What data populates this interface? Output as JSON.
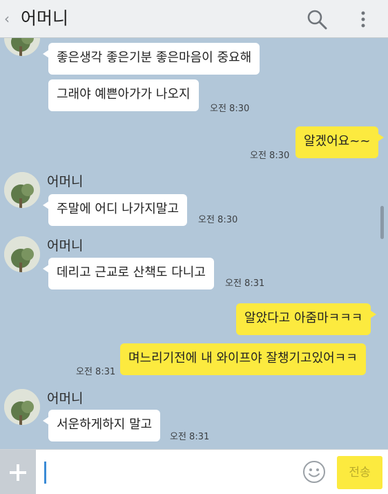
{
  "header": {
    "back_icon": "chevron-left-icon",
    "title": "어머니",
    "search_icon": "search-icon",
    "more_icon": "more-vertical-icon"
  },
  "colors": {
    "background": "#b2c7d9",
    "incoming_bubble": "#ffffff",
    "outgoing_bubble": "#fcea3f"
  },
  "messages": [
    {
      "direction": "in",
      "text": "좋은생각 좋은기분 좋은마음이 중요해"
    },
    {
      "direction": "in",
      "text": "그래야 예쁜아가가 나오지",
      "time": "오전 8:30"
    },
    {
      "direction": "out",
      "text": "알겠어요~~",
      "time": "오전 8:30"
    },
    {
      "direction": "in",
      "sender": "어머니",
      "text": "주말에 어디 나가지말고",
      "time": "오전 8:30"
    },
    {
      "direction": "in",
      "sender": "어머니",
      "text": "데리고 근교로 산책도 다니고",
      "time": "오전 8:31"
    },
    {
      "direction": "out",
      "text": "알았다고 아줌마ㅋㅋㅋ"
    },
    {
      "direction": "out",
      "text": "며느리기전에 내 와이프야 잘챙기고있어ㅋㅋ",
      "time": "오전 8:31"
    },
    {
      "direction": "in",
      "sender": "어머니",
      "text": "서운하게하지 말고",
      "time": "오전 8:31"
    }
  ],
  "input": {
    "plus_icon": "plus-icon",
    "value": "",
    "emoji_icon": "smiley-icon",
    "send_label": "전송"
  }
}
